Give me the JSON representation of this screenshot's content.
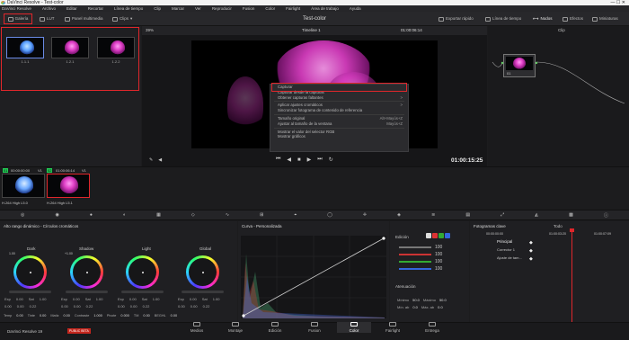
{
  "window": {
    "title": "DaVinci Resolve - Test-color"
  },
  "menu": [
    "DaVinci Resolve",
    "Archivo",
    "Editar",
    "Recortar",
    "Línea de tiempo",
    "Clip",
    "Marcar",
    "Ver",
    "Reproducir",
    "Fusion",
    "Color",
    "Fairlight",
    "Área de trabajo",
    "Ayuda"
  ],
  "toolbar": {
    "gallery": "Galería",
    "lut": "LUT",
    "media_pool": "Panel multimedia",
    "clips": "Clips",
    "project_title": "Test-color",
    "quick_export": "Exportar rápido",
    "timeline": "Línea de tiempo",
    "nodes": "Nodos",
    "effects": "Efectos",
    "thumbnails": "Miniaturas"
  },
  "viewer_bar": {
    "zoom": "39%",
    "timeline_name": "Timeline 1",
    "timecode": "01:00:06:14",
    "mode": "Clip"
  },
  "gallery": {
    "stills": [
      {
        "label": "1.1.1"
      },
      {
        "label": "1.2.1"
      },
      {
        "label": "1.2.2"
      }
    ]
  },
  "context_menu": {
    "items": [
      {
        "label": "Capturar",
        "shortcut": ""
      },
      {
        "label": "Capturar desde la capturas",
        "shortcut": ""
      },
      {
        "label": "Obtener capturas faltantes",
        "shortcut": ">"
      },
      {
        "label": "Aplicar ajustes cromáticos",
        "shortcut": ">"
      },
      {
        "label": "Sincronizar fotograma de contenido de referencia",
        "shortcut": ""
      },
      {
        "label": "Tamaño original",
        "shortcut": "Alt+Mayús+Z"
      },
      {
        "label": "Ajustar al tamaño de la ventana",
        "shortcut": "Mayús+Z"
      },
      {
        "label": "Mostrar el valor del selector RGB",
        "shortcut": ""
      },
      {
        "label": "Mostrar gráficos",
        "shortcut": ""
      }
    ]
  },
  "transport": {
    "timecode": "01:00:15:25"
  },
  "node": {
    "label": "01"
  },
  "clips": [
    {
      "number": "01",
      "timecode": "00:00:00:00",
      "track": "V1",
      "codec": "H.264 High L5.0"
    },
    {
      "number": "02",
      "timecode": "01:00:06:14",
      "track": "V1",
      "codec": "H.264 High L5.1"
    }
  ],
  "primaries": {
    "title": "Alto rango dinámico - Círculos cromáticos",
    "wheels": [
      {
        "name": "Dark",
        "value": "1.00",
        "exp": "0.00",
        "sat": "1.00",
        "r": "0.00",
        "g": "0.00",
        "b": "0.22"
      },
      {
        "name": "Shadow",
        "value": "+1.00",
        "exp": "0.00",
        "sat": "1.00",
        "r": "0.00",
        "g": "0.00",
        "b": "0.22"
      },
      {
        "name": "Light",
        "value": "",
        "exp": "0.00",
        "sat": "1.00",
        "r": "0.00",
        "g": "0.00",
        "b": "0.22"
      },
      {
        "name": "Global",
        "value": "",
        "exp": "0.00",
        "sat": "1.00",
        "r": "0.00",
        "g": "0.00",
        "b": "0.22"
      }
    ],
    "bottom": [
      {
        "k": "Temp",
        "v": "0.00"
      },
      {
        "k": "Tinte",
        "v": "0.00"
      },
      {
        "k": "Matiz",
        "v": "0.00"
      },
      {
        "k": "Contraste",
        "v": "1.000"
      },
      {
        "k": "Pivote",
        "v": "0.000"
      },
      {
        "k": "TM",
        "v": "0.00"
      },
      {
        "k": "BEGHL",
        "v": "0.00"
      }
    ],
    "labels": {
      "exp": "Exp",
      "sat": "Sat"
    }
  },
  "curves": {
    "title": "Curva - Personalizada",
    "edit_label": "Edición",
    "values": [
      "100",
      "100",
      "100",
      "100"
    ],
    "attenuation": "Atenuación",
    "min_label": "Mínimo",
    "min_value": "50.0",
    "max_label": "Máximo",
    "max_value": "50.0",
    "minatt_label": "Mín. ab",
    "minatt_value": "0.0",
    "maxatt_label": "Máx. ab",
    "maxatt_value": "0.0"
  },
  "keyframes": {
    "title": "Fotogramas clave",
    "filter": "Todo",
    "tc1": "00:00:00:00",
    "tc2": "01:00:03:20",
    "tc3": "01:00:07:09",
    "rows": [
      "Principal",
      "Corrector 1",
      "Ajuste de tam..."
    ]
  },
  "pages": [
    "Medios",
    "Montaje",
    "Edición",
    "Fusion",
    "Color",
    "Fairlight",
    "Entrega"
  ],
  "footer": {
    "app": "DaVinci Resolve 19",
    "beta": "PUBLIC BETA"
  },
  "colors": {
    "accent_red": "#e0262b",
    "active_page": "#ffffff",
    "bg": "#1c1c1e"
  }
}
